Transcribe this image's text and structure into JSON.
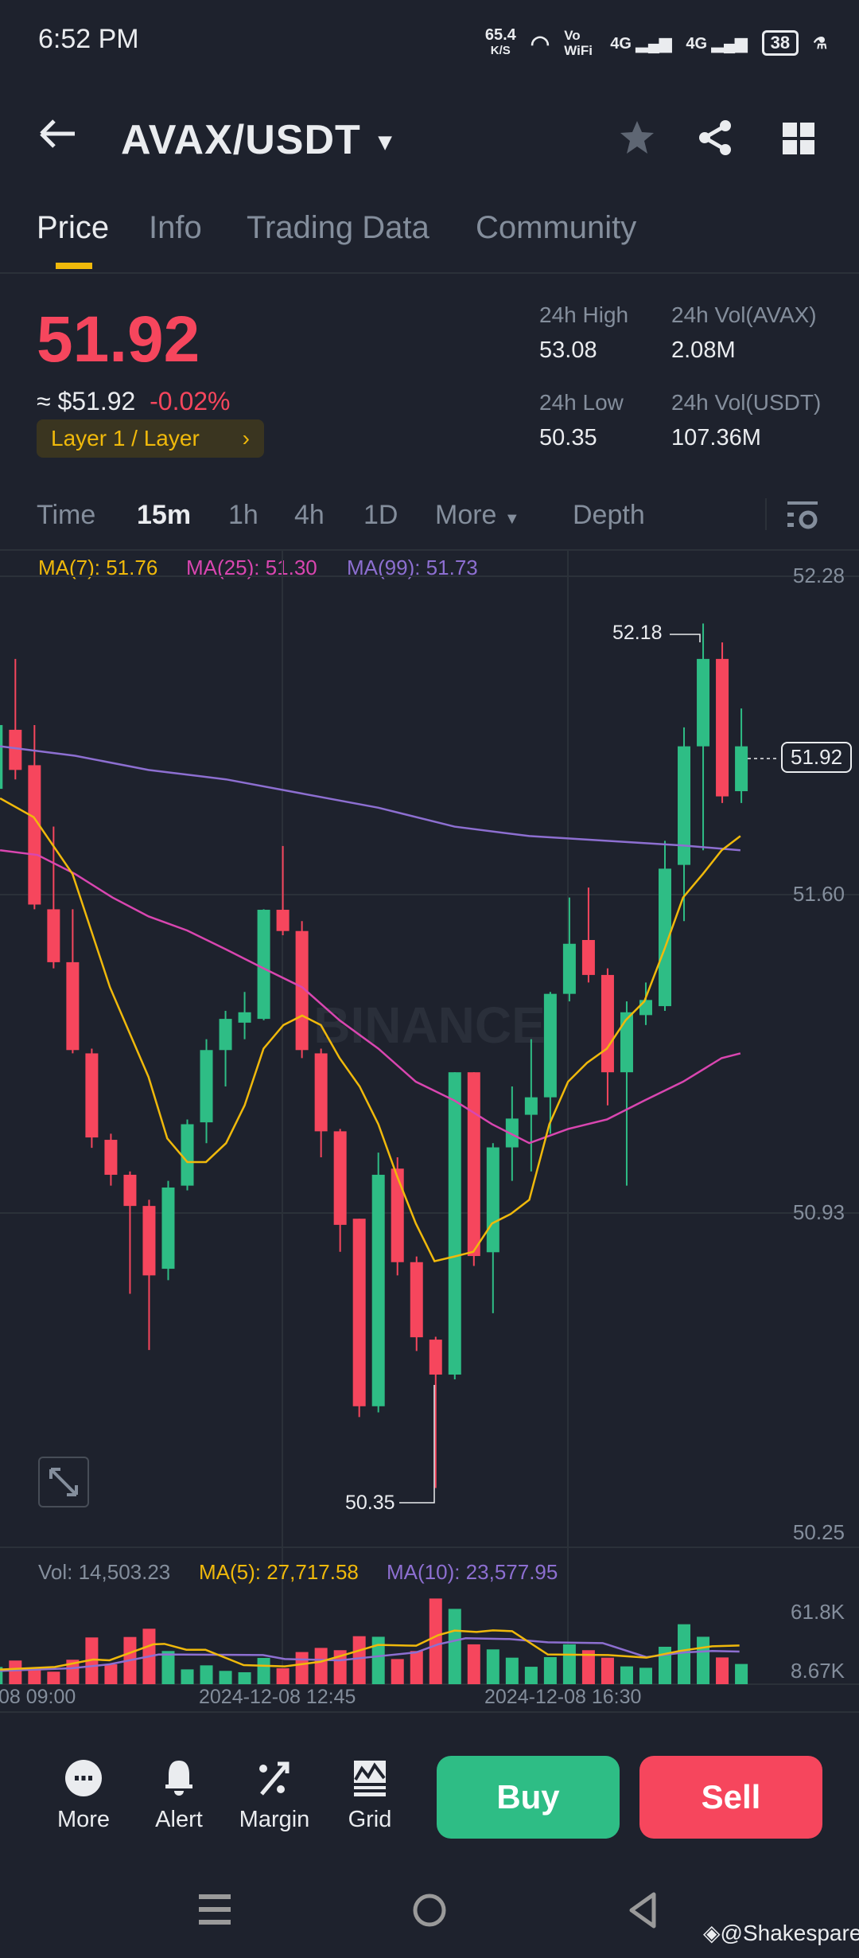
{
  "status": {
    "time": "6:52 PM",
    "speed": "65.4",
    "speed_unit": "K/S",
    "vowifi": "Vo WiFi",
    "net1": "4G",
    "net2": "4G",
    "battery": "38"
  },
  "header": {
    "pair": "AVAX/USDT"
  },
  "tabs": [
    "Price",
    "Info",
    "Trading Data",
    "Community"
  ],
  "ticker": {
    "price": "51.92",
    "approx": "≈ $51.92",
    "change": "-0.02%",
    "tag": "Layer 1 / Layer",
    "stats": [
      {
        "label": "24h High",
        "value": "53.08"
      },
      {
        "label": "24h Vol(AVAX)",
        "value": "2.08M"
      },
      {
        "label": "24h Low",
        "value": "50.35"
      },
      {
        "label": "24h Vol(USDT)",
        "value": "107.36M"
      }
    ]
  },
  "intervals": [
    "Time",
    "15m",
    "1h",
    "4h",
    "1D",
    "More",
    "Depth"
  ],
  "legend": {
    "ma7": "MA(7): 51.76",
    "ma25": "MA(25): 51.30",
    "ma99": "MA(99): 51.73",
    "vol": "Vol: 14,503.23",
    "vma5": "MA(5): 27,717.58",
    "vma10": "MA(10): 23,577.95"
  },
  "watermark": "BINANCE",
  "colors": {
    "up": "#2ebd85",
    "down": "#f6465d",
    "ma7": "#f0b90b",
    "ma25": "#d946b0",
    "ma99": "#8d6fd1",
    "accent": "#f0b90b"
  },
  "chart_data": {
    "type": "candlestick",
    "price_axis": [
      "52.28",
      "51.60",
      "50.93",
      "50.25"
    ],
    "ylim": [
      50.25,
      52.28
    ],
    "current_price": "51.92",
    "high_label": "52.18",
    "low_label": "50.35",
    "candles": [
      [
        51.83,
        52.0,
        51.8,
        51.965
      ],
      [
        51.955,
        52.105,
        51.85,
        51.87
      ],
      [
        51.88,
        51.965,
        51.575,
        51.585
      ],
      [
        51.575,
        51.75,
        51.45,
        51.463
      ],
      [
        51.463,
        51.575,
        51.27,
        51.277
      ],
      [
        51.27,
        51.28,
        51.07,
        51.092
      ],
      [
        51.087,
        51.1,
        50.99,
        51.013
      ],
      [
        51.013,
        51.02,
        50.761,
        50.947
      ],
      [
        50.947,
        50.96,
        50.642,
        50.8
      ],
      [
        50.814,
        51.0,
        50.79,
        50.986
      ],
      [
        50.99,
        51.13,
        50.98,
        51.12
      ],
      [
        51.124,
        51.3,
        51.08,
        51.277
      ],
      [
        51.277,
        51.36,
        51.2,
        51.343
      ],
      [
        51.335,
        51.4,
        51.3,
        51.357
      ],
      [
        51.343,
        51.575,
        51.34,
        51.574
      ],
      [
        51.574,
        51.709,
        51.52,
        51.529
      ],
      [
        51.529,
        51.55,
        51.26,
        51.277
      ],
      [
        51.27,
        51.28,
        51.05,
        51.105
      ],
      [
        51.105,
        51.11,
        50.85,
        50.907
      ],
      [
        50.92,
        50.92,
        50.5,
        50.523
      ],
      [
        50.523,
        51.06,
        50.51,
        51.013
      ],
      [
        51.026,
        51.05,
        50.8,
        50.828
      ],
      [
        50.828,
        50.84,
        50.64,
        50.669
      ],
      [
        50.664,
        50.67,
        50.35,
        50.59
      ],
      [
        50.59,
        51.23,
        50.58,
        51.23
      ],
      [
        51.23,
        51.23,
        50.82,
        50.841
      ],
      [
        50.849,
        51.08,
        50.72,
        51.071
      ],
      [
        51.071,
        51.2,
        51.0,
        51.132
      ],
      [
        51.14,
        51.3,
        51.02,
        51.177
      ],
      [
        51.177,
        51.4,
        51.1,
        51.396
      ],
      [
        51.396,
        51.6,
        51.38,
        51.502
      ],
      [
        51.51,
        51.621,
        51.42,
        51.436
      ],
      [
        51.436,
        51.45,
        51.16,
        51.23
      ],
      [
        51.23,
        51.38,
        50.99,
        51.357
      ],
      [
        51.351,
        51.42,
        51.33,
        51.383
      ],
      [
        51.37,
        51.72,
        51.36,
        51.661
      ],
      [
        51.669,
        51.96,
        51.55,
        51.92
      ],
      [
        51.92,
        52.18,
        51.7,
        52.105
      ],
      [
        52.105,
        52.14,
        51.8,
        51.814
      ],
      [
        51.825,
        52.0,
        51.8,
        51.92
      ]
    ],
    "ma7": [
      [
        0.2,
        51.81
      ],
      [
        1.96,
        51.77
      ],
      [
        3.99,
        51.65
      ],
      [
        5.95,
        51.41
      ],
      [
        7.97,
        51.22
      ],
      [
        8.95,
        51.09
      ],
      [
        10,
        51.04
      ],
      [
        10.98,
        51.04
      ],
      [
        12.03,
        51.08
      ],
      [
        13,
        51.16
      ],
      [
        13.99,
        51.28
      ],
      [
        15.03,
        51.33
      ],
      [
        16.01,
        51.35
      ],
      [
        16.99,
        51.33
      ],
      [
        17.97,
        51.26
      ],
      [
        19.02,
        51.2
      ],
      [
        20,
        51.12
      ],
      [
        20.98,
        51.01
      ],
      [
        21.96,
        50.91
      ],
      [
        22.94,
        50.83
      ],
      [
        23.99,
        50.84
      ],
      [
        24.97,
        50.85
      ],
      [
        25.95,
        50.91
      ],
      [
        26.93,
        50.93
      ],
      [
        27.9,
        50.96
      ],
      [
        28.95,
        51.12
      ],
      [
        29.93,
        51.21
      ],
      [
        30.92,
        51.25
      ],
      [
        31.96,
        51.28
      ],
      [
        32.94,
        51.34
      ],
      [
        33.92,
        51.38
      ],
      [
        34.97,
        51.49
      ],
      [
        35.95,
        51.6
      ],
      [
        36.99,
        51.65
      ],
      [
        37.97,
        51.7
      ],
      [
        38.95,
        51.73
      ]
    ],
    "ma25": [
      [
        0.2,
        51.7
      ],
      [
        2.16,
        51.69
      ],
      [
        4.12,
        51.65
      ],
      [
        6.08,
        51.6
      ],
      [
        7.97,
        51.56
      ],
      [
        10,
        51.53
      ],
      [
        12.03,
        51.49
      ],
      [
        13.99,
        51.45
      ],
      [
        16.01,
        51.41
      ],
      [
        17.97,
        51.34
      ],
      [
        20,
        51.28
      ],
      [
        21.96,
        51.21
      ],
      [
        23.99,
        51.17
      ],
      [
        25.95,
        51.12
      ],
      [
        27.9,
        51.08
      ],
      [
        29.93,
        51.11
      ],
      [
        31.96,
        51.13
      ],
      [
        33.92,
        51.17
      ],
      [
        35.95,
        51.21
      ],
      [
        37.97,
        51.26
      ],
      [
        38.95,
        51.27
      ]
    ],
    "ma99": [
      [
        0.2,
        51.92
      ],
      [
        4.12,
        51.9
      ],
      [
        7.97,
        51.87
      ],
      [
        12.03,
        51.85
      ],
      [
        16.01,
        51.82
      ],
      [
        20,
        51.79
      ],
      [
        23.99,
        51.75
      ],
      [
        27.9,
        51.73
      ],
      [
        31.96,
        51.72
      ],
      [
        35.95,
        51.71
      ],
      [
        38.95,
        51.7
      ]
    ],
    "volume_axis": [
      "61.8K",
      "8.67K"
    ],
    "volume_k": [
      15,
      20.6,
      13.9,
      10.9,
      21.3,
      40.7,
      17.3,
      41.1,
      48.3,
      28.9,
      12.9,
      16.4,
      11.6,
      10.4,
      22.9,
      13.9,
      28,
      31.6,
      29.6,
      41.8,
      41.3,
      21.9,
      28.9,
      74.6,
      65.6,
      34.7,
      30.3,
      23.1,
      15.2,
      23.6,
      34.7,
      29.6,
      23.1,
      15.5,
      14.3,
      32.6,
      52.2,
      41.3,
      23.3,
      17.6
    ],
    "vol_ma5": [
      [
        0.2,
        12.7
      ],
      [
        3.06,
        15
      ],
      [
        5.07,
        21.5
      ],
      [
        5.93,
        20.8
      ],
      [
        8.22,
        34.7
      ],
      [
        8.8,
        35.1
      ],
      [
        9.95,
        30
      ],
      [
        10.95,
        30
      ],
      [
        12.95,
        16.6
      ],
      [
        15.1,
        15.5
      ],
      [
        16.97,
        19.6
      ],
      [
        17.97,
        24.3
      ],
      [
        19.98,
        34.2
      ],
      [
        21.98,
        33.5
      ],
      [
        23.13,
        42.7
      ],
      [
        23.99,
        46.7
      ],
      [
        25.14,
        45.5
      ],
      [
        26,
        46.9
      ],
      [
        27,
        46.2
      ],
      [
        28.87,
        25.9
      ],
      [
        32.02,
        25.4
      ],
      [
        34.03,
        23.1
      ],
      [
        35.75,
        28.9
      ],
      [
        37.47,
        33
      ],
      [
        38.9,
        33.7
      ]
    ],
    "vol_ma10": [
      [
        0.2,
        11.6
      ],
      [
        3.92,
        13.9
      ],
      [
        5.93,
        17.3
      ],
      [
        8.51,
        25.9
      ],
      [
        13.96,
        25.4
      ],
      [
        15.1,
        21.9
      ],
      [
        17.97,
        20.8
      ],
      [
        19.98,
        24.3
      ],
      [
        21.98,
        27.7
      ],
      [
        23.13,
        34.7
      ],
      [
        24.57,
        40
      ],
      [
        26.86,
        39.3
      ],
      [
        28.87,
        36.5
      ],
      [
        31.74,
        35.8
      ],
      [
        34.03,
        23.6
      ],
      [
        36.04,
        27.7
      ],
      [
        37.47,
        28.9
      ],
      [
        38.9,
        28.4
      ]
    ],
    "time_labels": [
      "08 09:00",
      "2024-12-08 12:45",
      "2024-12-08 16:30"
    ]
  },
  "toolbar": {
    "more": "More",
    "alert": "Alert",
    "margin": "Margin",
    "grid": "Grid",
    "buy": "Buy",
    "sell": "Sell"
  },
  "watermark_credit": "@Shakespare"
}
